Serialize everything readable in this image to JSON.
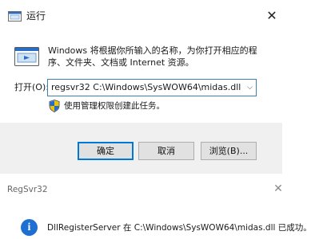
{
  "run_dialog": {
    "title": "运行",
    "close_glyph": "✕",
    "description": "Windows 将根据你所输入的名称，为你打开相应的程序、文件夹、文档或 Internet 资源。",
    "open_label": "打开(O):",
    "command_value": "regsvr32 C:\\Windows\\SysWOW64\\midas.dll",
    "dropdown_glyph": "⌵",
    "admin_note": "使用管理权限创建此任务。",
    "buttons": {
      "ok": "确定",
      "cancel": "取消",
      "browse": "浏览(B)..."
    },
    "icons": [
      "run-icon",
      "shield-icon"
    ]
  },
  "regsvr_dialog": {
    "title": "RegSvr32",
    "close_glyph": "✕",
    "info_glyph": "i",
    "message": "DllRegisterServer 在 C:\\Windows\\SysWOW64\\midas.dll 已成功。",
    "icons": [
      "info-icon"
    ]
  },
  "colors": {
    "accent": "#0078d7",
    "info_blue": "#1d6fd1",
    "button_bar": "#f0f0f0"
  }
}
